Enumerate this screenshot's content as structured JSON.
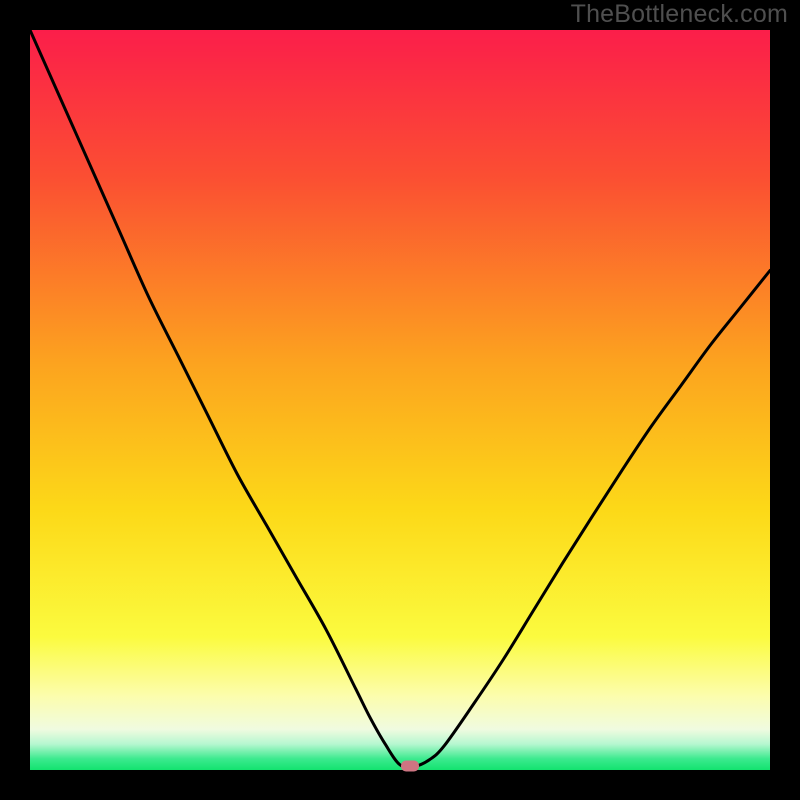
{
  "watermark": "TheBottleneck.com",
  "chart_data": {
    "type": "line",
    "title": "",
    "xlabel": "",
    "ylabel": "",
    "xlim": [
      0,
      100
    ],
    "ylim": [
      0,
      100
    ],
    "grid": false,
    "legend": false,
    "background": "red-yellow-green-gradient",
    "gradient_stops": [
      {
        "pos": 0.0,
        "color": "#fb1e4a"
      },
      {
        "pos": 0.2,
        "color": "#fb4f32"
      },
      {
        "pos": 0.45,
        "color": "#fca31f"
      },
      {
        "pos": 0.65,
        "color": "#fcd918"
      },
      {
        "pos": 0.82,
        "color": "#fbfb3f"
      },
      {
        "pos": 0.9,
        "color": "#fcfdad"
      },
      {
        "pos": 0.945,
        "color": "#f0fbe0"
      },
      {
        "pos": 0.965,
        "color": "#b6f7d0"
      },
      {
        "pos": 0.985,
        "color": "#3bea8e"
      },
      {
        "pos": 1.0,
        "color": "#13e36f"
      }
    ],
    "series": [
      {
        "name": "bottleneck-curve",
        "x": [
          0,
          4,
          8,
          12,
          16,
          20,
          24,
          28,
          32,
          36,
          40,
          44,
          46,
          48,
          50,
          52,
          54,
          56,
          60,
          64,
          68,
          72,
          76,
          80,
          84,
          88,
          92,
          96,
          100
        ],
        "y": [
          100,
          91,
          82,
          73,
          64,
          56,
          48,
          40,
          33,
          26,
          19,
          11,
          7,
          3.5,
          0.7,
          0.5,
          1.4,
          3.3,
          9,
          15,
          21.5,
          28,
          34.3,
          40.5,
          46.5,
          52,
          57.5,
          62.5,
          67.5
        ]
      }
    ],
    "marker": {
      "name": "optimal-point",
      "x": 51.3,
      "y": 0.6,
      "color": "#cd7582"
    }
  }
}
